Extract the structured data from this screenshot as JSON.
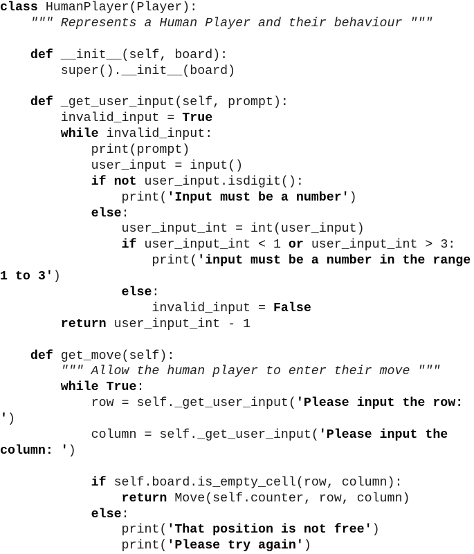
{
  "document": {
    "language": "python",
    "lines": [
      [
        {
          "t": "kw",
          "v": "class"
        },
        {
          "t": "plain",
          "v": " HumanPlayer(Player):"
        }
      ],
      [
        {
          "t": "plain",
          "v": "    "
        },
        {
          "t": "doc",
          "v": "\"\"\" Represents a Human Player and their behaviour \"\"\""
        }
      ],
      [],
      [
        {
          "t": "plain",
          "v": "    "
        },
        {
          "t": "kw",
          "v": "def"
        },
        {
          "t": "plain",
          "v": " __init__(self, board):"
        }
      ],
      [
        {
          "t": "plain",
          "v": "        super().__init__(board)"
        }
      ],
      [],
      [
        {
          "t": "plain",
          "v": "    "
        },
        {
          "t": "kw",
          "v": "def"
        },
        {
          "t": "plain",
          "v": " _get_user_input(self, prompt):"
        }
      ],
      [
        {
          "t": "plain",
          "v": "        invalid_input = "
        },
        {
          "t": "kw",
          "v": "True"
        }
      ],
      [
        {
          "t": "plain",
          "v": "        "
        },
        {
          "t": "kw",
          "v": "while"
        },
        {
          "t": "plain",
          "v": " invalid_input:"
        }
      ],
      [
        {
          "t": "plain",
          "v": "            print(prompt)"
        }
      ],
      [
        {
          "t": "plain",
          "v": "            user_input = input()"
        }
      ],
      [
        {
          "t": "plain",
          "v": "            "
        },
        {
          "t": "kw",
          "v": "if not"
        },
        {
          "t": "plain",
          "v": " user_input.isdigit():"
        }
      ],
      [
        {
          "t": "plain",
          "v": "                print("
        },
        {
          "t": "str",
          "v": "'Input must be a number'"
        },
        {
          "t": "plain",
          "v": ")"
        }
      ],
      [
        {
          "t": "plain",
          "v": "            "
        },
        {
          "t": "kw",
          "v": "else"
        },
        {
          "t": "plain",
          "v": ":"
        }
      ],
      [
        {
          "t": "plain",
          "v": "                user_input_int = int(user_input)"
        }
      ],
      [
        {
          "t": "plain",
          "v": "                "
        },
        {
          "t": "kw",
          "v": "if"
        },
        {
          "t": "plain",
          "v": " user_input_int < 1 "
        },
        {
          "t": "kw",
          "v": "or"
        },
        {
          "t": "plain",
          "v": " user_input_int > 3:"
        }
      ],
      [
        {
          "t": "plain",
          "v": "                    print("
        },
        {
          "t": "str",
          "v": "'input must be a number in the range"
        }
      ],
      [
        {
          "t": "str",
          "v": "1 to 3'"
        },
        {
          "t": "plain",
          "v": ")"
        }
      ],
      [
        {
          "t": "plain",
          "v": "                "
        },
        {
          "t": "kw",
          "v": "else"
        },
        {
          "t": "plain",
          "v": ":"
        }
      ],
      [
        {
          "t": "plain",
          "v": "                    invalid_input = "
        },
        {
          "t": "kw",
          "v": "False"
        }
      ],
      [
        {
          "t": "plain",
          "v": "        "
        },
        {
          "t": "kw",
          "v": "return"
        },
        {
          "t": "plain",
          "v": " user_input_int - 1"
        }
      ],
      [],
      [
        {
          "t": "plain",
          "v": "    "
        },
        {
          "t": "kw",
          "v": "def"
        },
        {
          "t": "plain",
          "v": " get_move(self):"
        }
      ],
      [
        {
          "t": "plain",
          "v": "        "
        },
        {
          "t": "doc",
          "v": "\"\"\" Allow the human player to enter their move \"\"\""
        }
      ],
      [
        {
          "t": "plain",
          "v": "        "
        },
        {
          "t": "kw",
          "v": "while True"
        },
        {
          "t": "plain",
          "v": ":"
        }
      ],
      [
        {
          "t": "plain",
          "v": "            row = self._get_user_input("
        },
        {
          "t": "str",
          "v": "'Please input the row:"
        }
      ],
      [
        {
          "t": "str",
          "v": "'"
        },
        {
          "t": "plain",
          "v": ")"
        }
      ],
      [
        {
          "t": "plain",
          "v": "            column = self._get_user_input("
        },
        {
          "t": "str",
          "v": "'Please input the"
        }
      ],
      [
        {
          "t": "str",
          "v": "column: '"
        },
        {
          "t": "plain",
          "v": ")"
        }
      ],
      [],
      [
        {
          "t": "plain",
          "v": "            "
        },
        {
          "t": "kw",
          "v": "if"
        },
        {
          "t": "plain",
          "v": " self.board.is_empty_cell(row, column):"
        }
      ],
      [
        {
          "t": "plain",
          "v": "                "
        },
        {
          "t": "kw",
          "v": "return"
        },
        {
          "t": "plain",
          "v": " Move(self.counter, row, column)"
        }
      ],
      [
        {
          "t": "plain",
          "v": "            "
        },
        {
          "t": "kw",
          "v": "else"
        },
        {
          "t": "plain",
          "v": ":"
        }
      ],
      [
        {
          "t": "plain",
          "v": "                print("
        },
        {
          "t": "str",
          "v": "'That position is not free'"
        },
        {
          "t": "plain",
          "v": ")"
        }
      ],
      [
        {
          "t": "plain",
          "v": "                print("
        },
        {
          "t": "str",
          "v": "'Please try again'"
        },
        {
          "t": "plain",
          "v": ")"
        }
      ]
    ]
  }
}
